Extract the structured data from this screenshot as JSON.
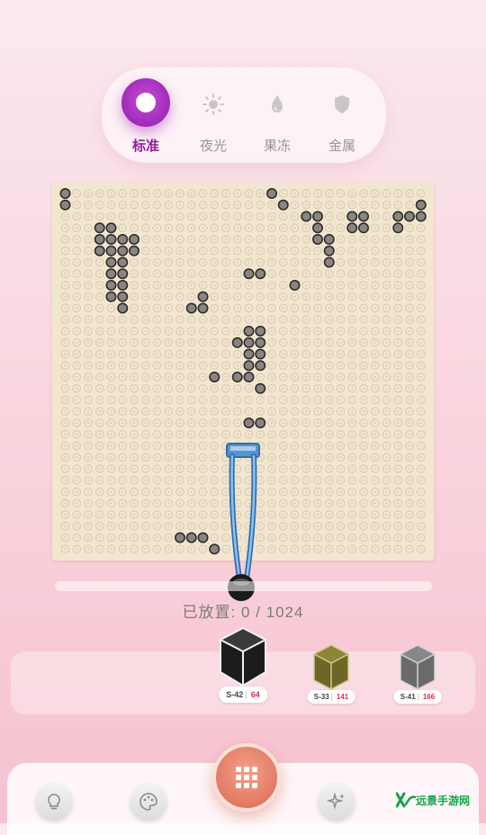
{
  "modes": [
    {
      "label": "标准",
      "icon": "circle-icon",
      "active": true
    },
    {
      "label": "夜光",
      "icon": "sun-icon",
      "active": false
    },
    {
      "label": "果冻",
      "icon": "droplet-icon",
      "active": false
    },
    {
      "label": "金属",
      "icon": "shield-icon",
      "active": false
    }
  ],
  "board": {
    "background_color": "#f2e6cf",
    "bead_color": "#8a8580",
    "empty_peg_color": "#dccfb6",
    "beads_placed_rows": {
      "0": [
        0,
        18
      ],
      "1": [
        0,
        19,
        31
      ],
      "2": [
        21,
        22,
        25,
        26,
        29,
        30,
        31
      ],
      "3": [
        3,
        4,
        22,
        25,
        26,
        29
      ],
      "4": [
        3,
        4,
        5,
        6,
        22,
        23
      ],
      "5": [
        3,
        4,
        5,
        6,
        23
      ],
      "6": [
        4,
        5,
        23
      ],
      "7": [
        4,
        5,
        16,
        17
      ],
      "8": [
        4,
        5,
        20
      ],
      "9": [
        4,
        5,
        12
      ],
      "10": [
        5,
        11,
        12
      ],
      "12": [
        16,
        17
      ],
      "13": [
        15,
        16,
        17
      ],
      "14": [
        16,
        17
      ],
      "15": [
        16,
        17
      ],
      "16": [
        13,
        15,
        16
      ],
      "17": [
        17
      ],
      "20": [
        16,
        17
      ],
      "30": [
        10,
        11,
        12
      ],
      "31": [
        13
      ]
    }
  },
  "progress": {
    "label": "已放置: ",
    "placed": 0,
    "total": 1024,
    "text": "0 / 1024"
  },
  "colors": [
    {
      "code": "S-42",
      "count": "64",
      "hex": "#1c1b1d",
      "selected": true
    },
    {
      "code": "S-33",
      "count": "141",
      "hex": "#6e6628",
      "selected": false
    },
    {
      "code": "S-41",
      "count": "166",
      "hex": "#6a6a6c",
      "selected": false
    }
  ],
  "bottom_bar": {
    "buttons": [
      {
        "name": "hint",
        "icon": "lightbulb-icon"
      },
      {
        "name": "palette",
        "icon": "palette-icon"
      },
      {
        "name": "grid",
        "icon": "grid-icon"
      },
      {
        "name": "sparkle",
        "icon": "sparkle-icon"
      }
    ]
  },
  "watermark": {
    "text": "远景手游网"
  },
  "accent_color": "#a02aba"
}
